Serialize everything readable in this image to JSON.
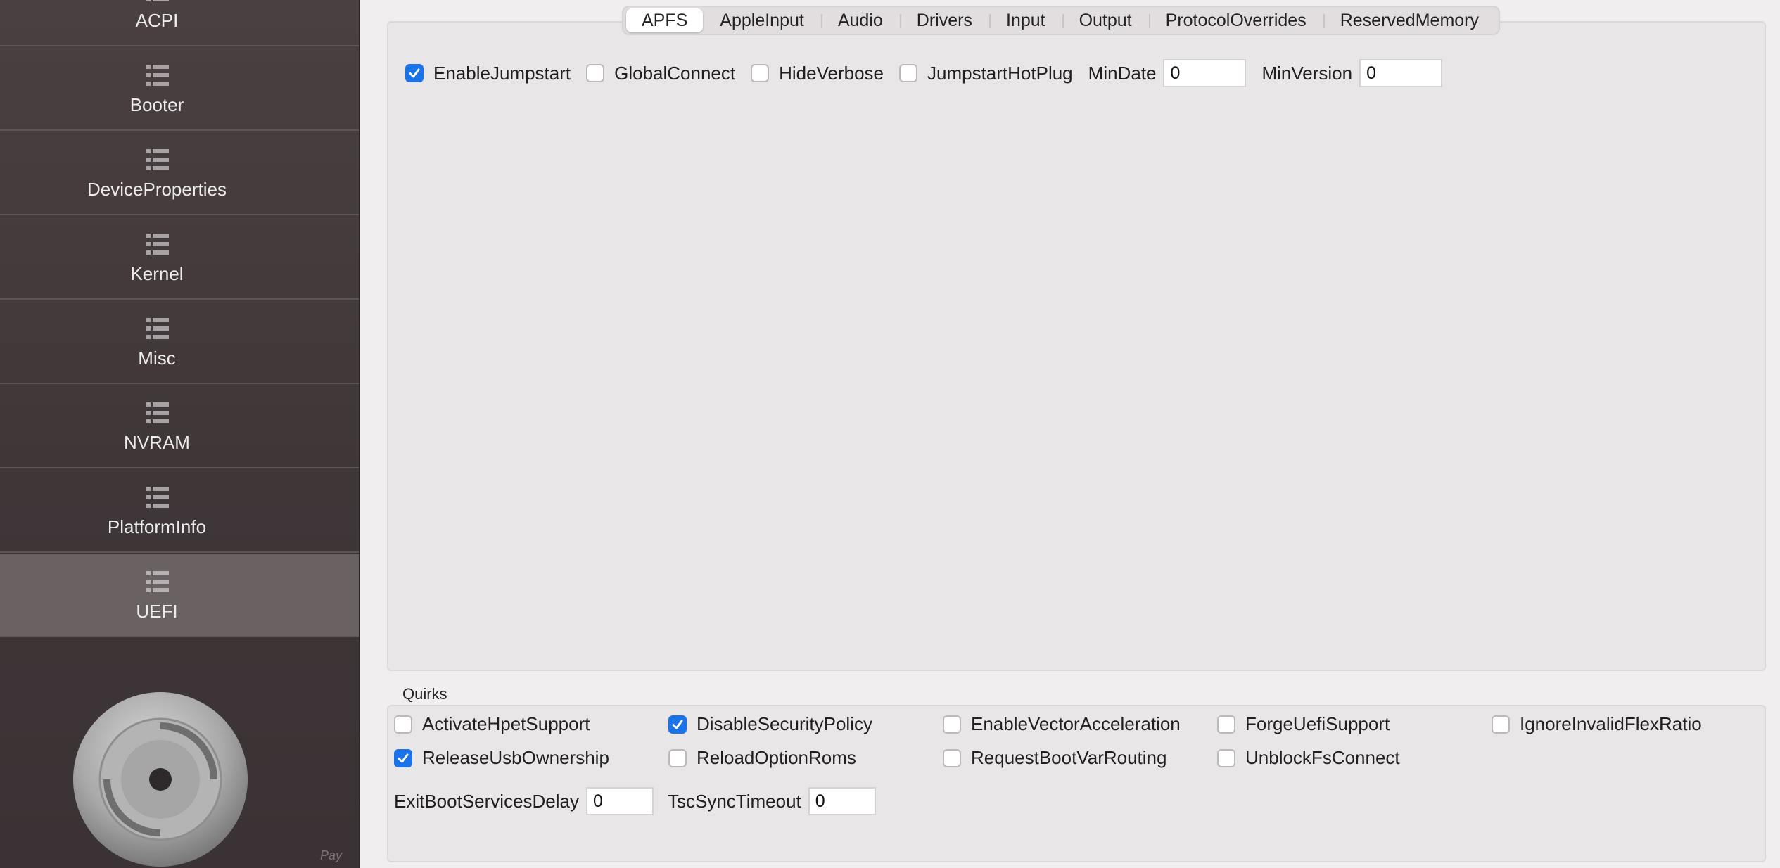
{
  "sidebar": {
    "items": [
      {
        "label": "ACPI"
      },
      {
        "label": "Booter"
      },
      {
        "label": "DeviceProperties"
      },
      {
        "label": "Kernel"
      },
      {
        "label": "Misc"
      },
      {
        "label": "NVRAM"
      },
      {
        "label": "PlatformInfo"
      },
      {
        "label": "UEFI",
        "selected": true
      }
    ],
    "icon": "list-icon",
    "footer_text": "Pay"
  },
  "tabs": [
    {
      "label": "APFS",
      "active": true
    },
    {
      "label": "AppleInput"
    },
    {
      "label": "Audio"
    },
    {
      "label": "Drivers"
    },
    {
      "label": "Input"
    },
    {
      "label": "Output"
    },
    {
      "label": "ProtocolOverrides"
    },
    {
      "label": "ReservedMemory"
    }
  ],
  "apfs": {
    "enable_jumpstart": {
      "label": "EnableJumpstart",
      "checked": true
    },
    "global_connect": {
      "label": "GlobalConnect",
      "checked": false
    },
    "hide_verbose": {
      "label": "HideVerbose",
      "checked": false
    },
    "jumpstart_hotplug": {
      "label": "JumpstartHotPlug",
      "checked": false
    },
    "min_date": {
      "label": "MinDate",
      "value": "0"
    },
    "min_version": {
      "label": "MinVersion",
      "value": "0"
    }
  },
  "quirks": {
    "title": "Quirks",
    "items": [
      {
        "label": "ActivateHpetSupport",
        "checked": false
      },
      {
        "label": "DisableSecurityPolicy",
        "checked": true
      },
      {
        "label": "EnableVectorAcceleration",
        "checked": false
      },
      {
        "label": "ForgeUefiSupport",
        "checked": false
      },
      {
        "label": "IgnoreInvalidFlexRatio",
        "checked": false
      },
      {
        "label": "ReleaseUsbOwnership",
        "checked": true
      },
      {
        "label": "ReloadOptionRoms",
        "checked": false
      },
      {
        "label": "RequestBootVarRouting",
        "checked": false
      },
      {
        "label": "UnblockFsConnect",
        "checked": false
      }
    ],
    "exit_boot_services_delay": {
      "label": "ExitBootServicesDelay",
      "value": "0"
    },
    "tsc_sync_timeout": {
      "label": "TscSyncTimeout",
      "value": "0"
    }
  },
  "colors": {
    "accent": "#1a73e8",
    "sidebar_bg": "#3f3638",
    "sidebar_selected": "#6a6163"
  }
}
